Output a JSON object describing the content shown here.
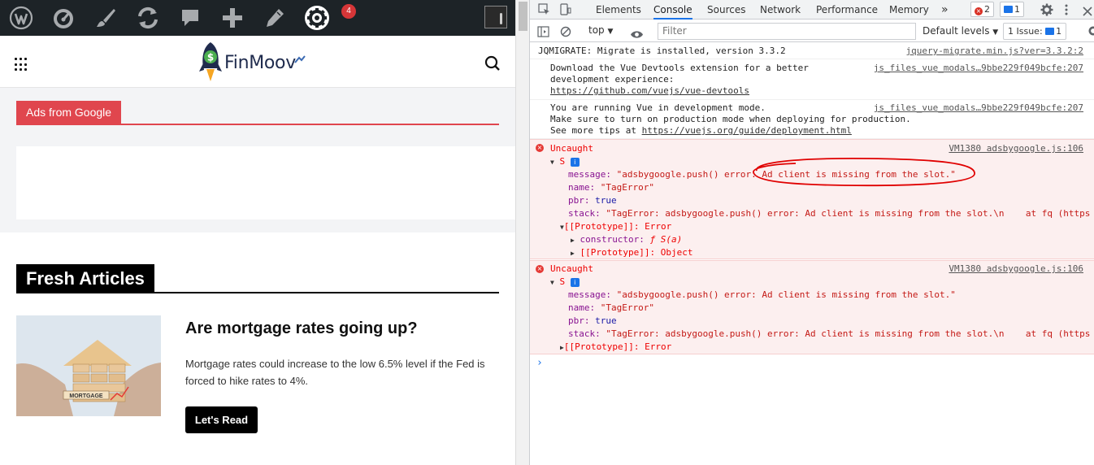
{
  "wp_admin_bar": {
    "icons": [
      "wordpress-icon",
      "dashboard-icon",
      "customize-icon",
      "updates-icon",
      "comments-icon",
      "new-content-icon",
      "edit-icon",
      "settings-icon"
    ],
    "notification_count": "4"
  },
  "site": {
    "logo_text": "FinMoov",
    "ads_label": "Ads from Google",
    "section_title": "Fresh Articles",
    "article": {
      "title": "Are mortgage rates going up?",
      "description": "Mortgage rates could increase to the low 6.5% level if the Fed is forced to hike rates to 4%.",
      "image_label": "MORTGAGE",
      "button": "Let's Read"
    }
  },
  "devtools": {
    "tabs": [
      "Elements",
      "Console",
      "Sources",
      "Network",
      "Performance",
      "Memory"
    ],
    "active_tab": "Console",
    "more": "»",
    "error_count": "2",
    "message_count": "1",
    "toolbar": {
      "context": "top",
      "filter_placeholder": "Filter",
      "levels": "Default levels",
      "issues_label": "1 Issue:",
      "issues_count": "1"
    },
    "messages": [
      {
        "lines": [
          "JQMIGRATE: Migrate is installed, version 3.3.2"
        ],
        "source": "jquery-migrate.min.js?ver=3.3.2:2"
      },
      {
        "lines": [
          "Download the Vue Devtools extension for a better",
          "development experience:"
        ],
        "link": "https://github.com/vuejs/vue-devtools",
        "source": "js_files_vue_modals…9bbe229f049bcfe:207"
      },
      {
        "lines": [
          "You are running Vue in development mode.",
          "Make sure to turn on production mode when deploying for production."
        ],
        "prefix": "See more tips at ",
        "link": "https://vuejs.org/guide/deployment.html",
        "source": "js_files_vue_modals…9bbe229f049bcfe:207"
      }
    ],
    "errors": [
      {
        "label": "Uncaught",
        "source": "VM1380 adsbygoogle.js:106",
        "object": "S",
        "message_key": "message:",
        "message_val": "\"adsbygoogle.push() error: Ad client is missing from the slot.\"",
        "name_key": "name:",
        "name_val": "\"TagError\"",
        "pbr_key": "pbr:",
        "pbr_val": "true",
        "stack_key": "stack:",
        "stack_val": "\"TagError: adsbygoogle.push() error: Ad client is missing from the slot.\\n    at fq (https",
        "proto": "[[Prototype]]: Error",
        "constructor_key": "constructor:",
        "constructor_val": "ƒ S(a)",
        "proto2": "[[Prototype]]: Object"
      },
      {
        "label": "Uncaught",
        "source": "VM1380 adsbygoogle.js:106",
        "object": "S",
        "message_key": "message:",
        "message_val": "\"adsbygoogle.push() error: Ad client is missing from the slot.\"",
        "name_key": "name:",
        "name_val": "\"TagError\"",
        "pbr_key": "pbr:",
        "pbr_val": "true",
        "stack_key": "stack:",
        "stack_val": "\"TagError: adsbygoogle.push() error: Ad client is missing from the slot.\\n    at fq (https",
        "proto": "[[Prototype]]: Error"
      }
    ],
    "prompt": "›"
  },
  "colors": {
    "wp_bar": "#1d2327",
    "ads_accent": "#e0464e",
    "error_bg": "#fcefef",
    "active_tab": "#1a73e8",
    "annotation": "#e00000"
  }
}
